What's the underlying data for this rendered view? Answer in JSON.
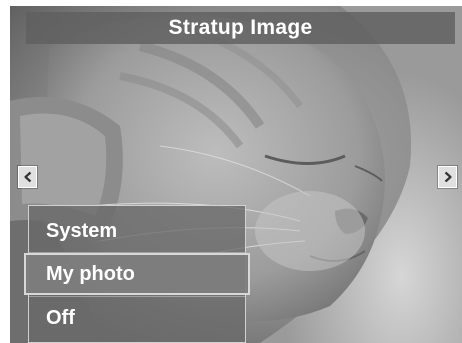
{
  "header": {
    "title": "Stratup Image"
  },
  "navigation": {
    "left_icon": "chevron-left-icon",
    "right_icon": "chevron-right-icon"
  },
  "menu": {
    "items": [
      {
        "label": "System",
        "selected": false
      },
      {
        "label": "My photo",
        "selected": true
      },
      {
        "label": "Off",
        "selected": false
      }
    ]
  },
  "colors": {
    "title_bar": "#5f5f5f",
    "menu_bg": "#696969",
    "selected_bg": "#7d7d7d",
    "text": "#ffffff"
  }
}
